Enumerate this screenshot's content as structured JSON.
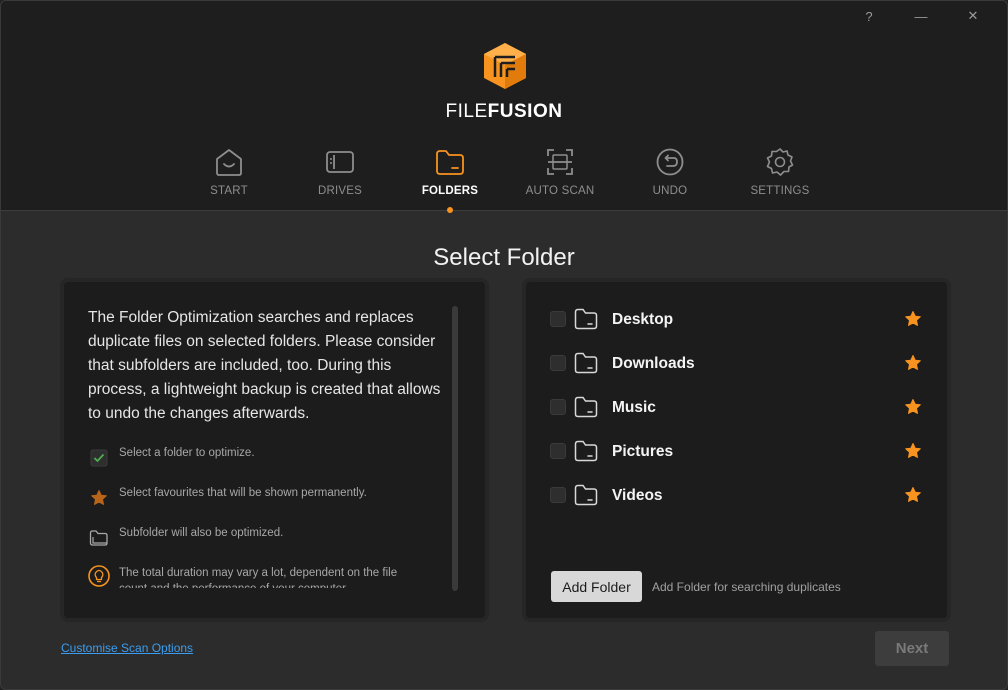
{
  "window": {
    "help_label": "?",
    "minimize_label": "—",
    "close_label": "✕"
  },
  "brand": {
    "part1": "FILE",
    "part2": "FUSION",
    "accent": "#f7931e"
  },
  "nav": {
    "start": "START",
    "drives": "DRIVES",
    "folders": "FOLDERS",
    "auto_scan": "AUTO SCAN",
    "undo": "UNDO",
    "settings": "SETTINGS",
    "active": "FOLDERS"
  },
  "main": {
    "title": "Select Folder",
    "info": "The Folder Optimization searches and replaces duplicate files on selected folders. Please consider that subfolders are included, too. During this process, a lightweight backup is created that allows to undo the changes afterwards.",
    "hints": {
      "select": "Select a folder to optimize.",
      "favourites": "Select favourites that will be shown permanently.",
      "subfolder": "Subfolder will also be optimized.",
      "duration": "The total duration may vary a lot, dependent on the file count and the performance of your computer."
    },
    "folders": [
      "Desktop",
      "Downloads",
      "Music",
      "Pictures",
      "Videos"
    ],
    "add_folder_label": "Add Folder",
    "add_folder_hint": "Add Folder for searching duplicates"
  },
  "footer": {
    "customise_label": "Customise Scan Options",
    "next_label": "Next"
  }
}
